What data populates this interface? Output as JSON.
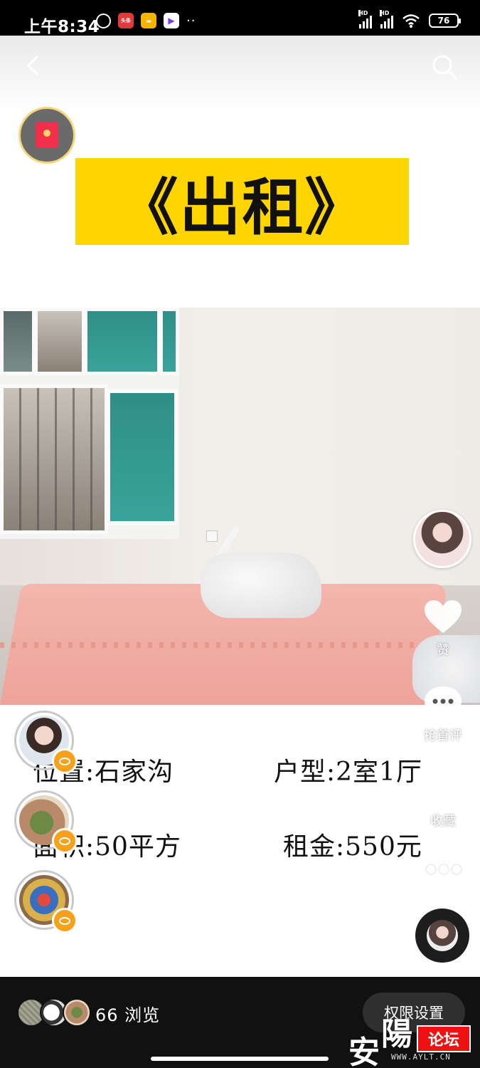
{
  "status_bar": {
    "time": "上午8:34",
    "notification_app": "头条",
    "battery": "76",
    "signal_label": "HD",
    "more_dots": "··"
  },
  "post": {
    "title": "《出租》",
    "info": {
      "location": "位置:石家沟",
      "layout": "户型:2室1厅",
      "area": "面积:50平方",
      "rent": "租金:550元"
    }
  },
  "actions": {
    "like_label": "赞",
    "comment_label": "抢首评",
    "favorite_label": "收藏"
  },
  "bottom_bar": {
    "views": "66 浏览",
    "permission_button": "权限设置"
  },
  "watermark": {
    "char1": "安",
    "char2": "陽",
    "box": "论坛",
    "url": "WWW.AYLT.CN"
  },
  "colors": {
    "title_banner": "#ffd500",
    "live_badge": "#f7a01c",
    "bottom_bar": "#111111"
  }
}
